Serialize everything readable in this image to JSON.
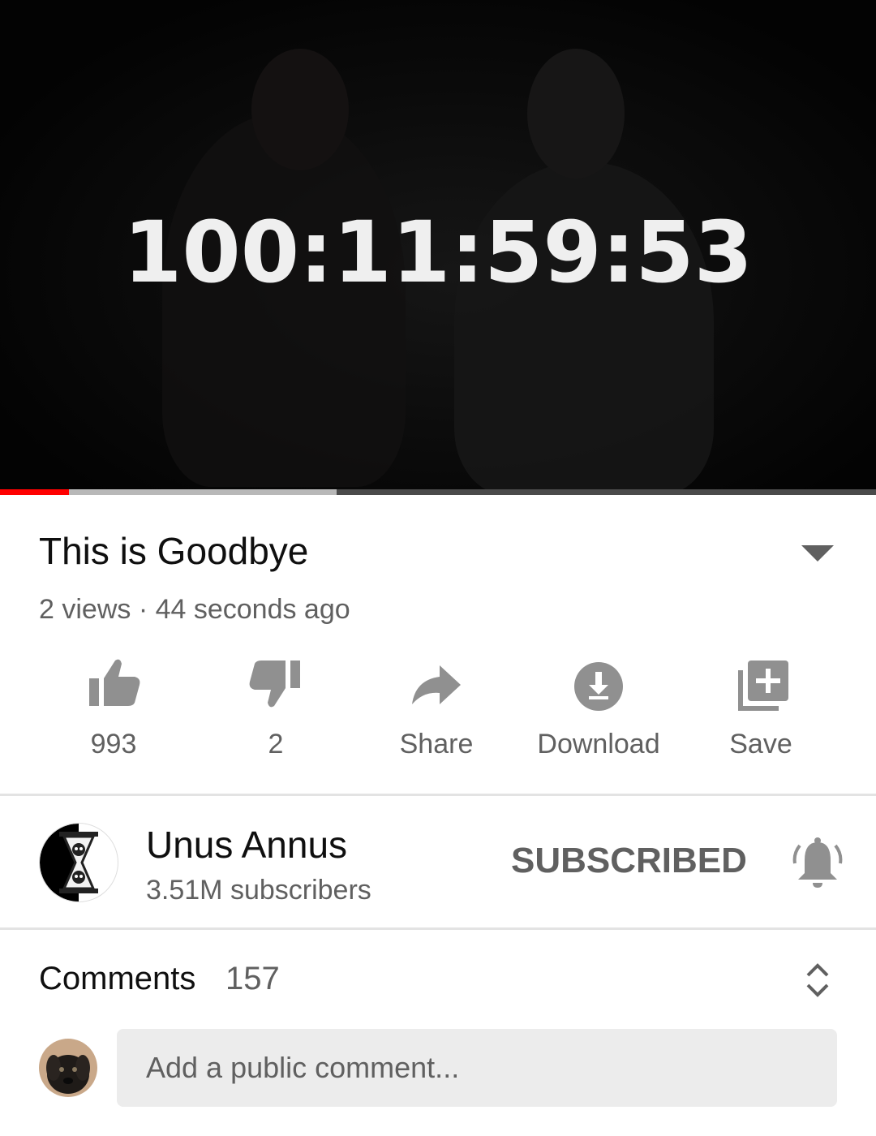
{
  "player": {
    "countdown": "100:11:59:53",
    "progress_played": 0.079,
    "progress_buffered": 0.384
  },
  "video": {
    "title": "This is Goodbye",
    "meta": "2 views · 44 seconds ago"
  },
  "actions": {
    "like_count": "993",
    "dislike_count": "2",
    "share_label": "Share",
    "download_label": "Download",
    "save_label": "Save"
  },
  "channel": {
    "name": "Unus Annus",
    "subscribers": "3.51M subscribers",
    "subscribe_state": "SUBSCRIBED"
  },
  "comments": {
    "label": "Comments",
    "count": "157",
    "placeholder": "Add a public comment..."
  },
  "colors": {
    "progress_played": "#ff0000",
    "progress_buffered": "#b8b8b8",
    "icon_gray": "#909090",
    "secondary_text": "#606060"
  }
}
